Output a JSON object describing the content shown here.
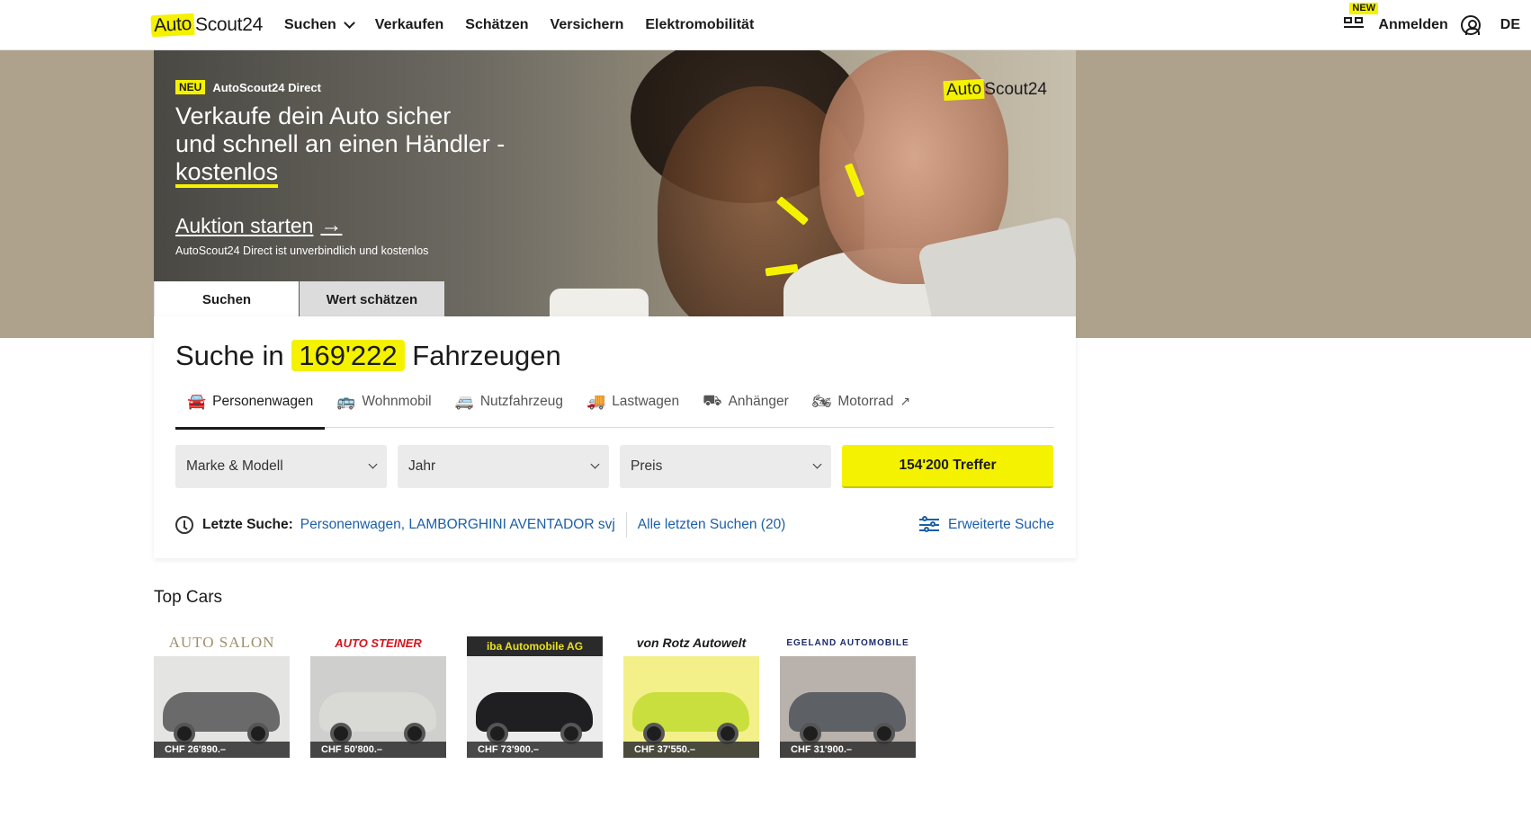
{
  "header": {
    "logo": {
      "part1": "Auto",
      "part2": "Scout24"
    },
    "nav": [
      {
        "label": "Suchen"
      },
      {
        "label": "Verkaufen"
      },
      {
        "label": "Schätzen"
      },
      {
        "label": "Versichern"
      },
      {
        "label": "Elektromobilität"
      }
    ],
    "new_badge": "NEW",
    "login_label": "Anmelden",
    "language": "DE"
  },
  "hero": {
    "badge": "NEU",
    "kicker": "AutoScout24 Direct",
    "title_line1": "Verkaufe dein Auto sicher",
    "title_line2": "und schnell an einen Händler -",
    "title_highlight": "kostenlos",
    "cta": "Auktion starten",
    "subtext": "AutoScout24 Direct ist unverbindlich und kostenlos",
    "logo": {
      "part1": "Auto",
      "part2": "Scout24"
    }
  },
  "search": {
    "tabs": [
      {
        "label": "Suchen",
        "active": true
      },
      {
        "label": "Wert schätzen",
        "active": false
      }
    ],
    "title_prefix": "Suche in",
    "count": "169'222",
    "title_suffix": "Fahrzeugen",
    "vehicle_types": [
      {
        "label": "Personenwagen",
        "icon": "car-icon",
        "active": true
      },
      {
        "label": "Wohnmobil",
        "icon": "camper-icon",
        "active": false
      },
      {
        "label": "Nutzfahrzeug",
        "icon": "van-icon",
        "active": false
      },
      {
        "label": "Lastwagen",
        "icon": "truck-icon",
        "active": false
      },
      {
        "label": "Anhänger",
        "icon": "trailer-icon",
        "active": false
      },
      {
        "label": "Motorrad",
        "icon": "motorcycle-icon",
        "active": false,
        "external": true
      }
    ],
    "fields": {
      "make_model": "Marke & Modell",
      "year": "Jahr",
      "price": "Preis"
    },
    "results_button": "154'200 Treffer",
    "recent_label": "Letzte Suche:",
    "recent_value": "Personenwagen, LAMBORGHINI AVENTADOR svj",
    "all_recent": "Alle letzten Suchen (20)",
    "advanced": "Erweiterte Suche"
  },
  "top_cars": {
    "title": "Top Cars",
    "items": [
      {
        "dealer": "AUTO SALON",
        "price": "CHF 26'890.–",
        "car_color": "#6a6a6a",
        "bg": "#e4e4e2"
      },
      {
        "dealer": "AUTO STEINER",
        "price": "CHF 50'800.–",
        "car_color": "#d9d9d6",
        "bg": "#cfcfcd"
      },
      {
        "dealer": "iba Automobile AG",
        "price": "CHF 73'900.–",
        "car_color": "#1f1f22",
        "bg": "#ececec"
      },
      {
        "dealer": "von Rotz Autowelt",
        "price": "CHF 37'550.–",
        "car_color": "#c9df3d",
        "bg": "#f3f08a"
      },
      {
        "dealer": "EGELAND AUTOMOBILE",
        "price": "CHF 31'900.–",
        "car_color": "#5d6166",
        "bg": "#b9b1ab"
      }
    ]
  },
  "colors": {
    "brand_yellow": "#f5f200",
    "link_blue": "#1c5fa8"
  }
}
